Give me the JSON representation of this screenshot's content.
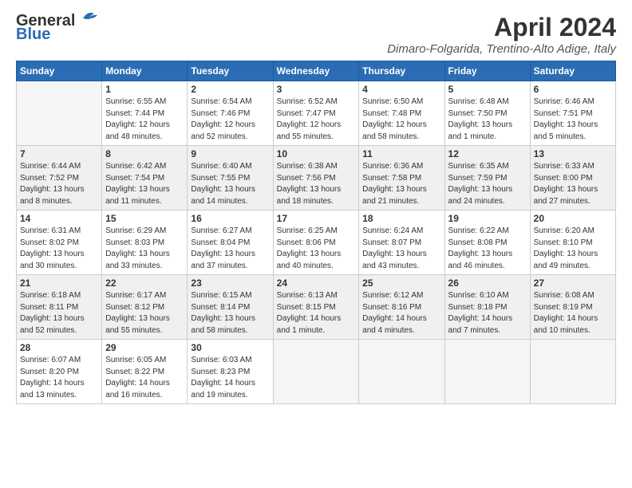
{
  "header": {
    "logo_line1": "General",
    "logo_line2": "Blue",
    "month_title": "April 2024",
    "location": "Dimaro-Folgarida, Trentino-Alto Adige, Italy"
  },
  "weekdays": [
    "Sunday",
    "Monday",
    "Tuesday",
    "Wednesday",
    "Thursday",
    "Friday",
    "Saturday"
  ],
  "weeks": [
    [
      {
        "day": "",
        "info": ""
      },
      {
        "day": "1",
        "info": "Sunrise: 6:55 AM\nSunset: 7:44 PM\nDaylight: 12 hours\nand 48 minutes."
      },
      {
        "day": "2",
        "info": "Sunrise: 6:54 AM\nSunset: 7:46 PM\nDaylight: 12 hours\nand 52 minutes."
      },
      {
        "day": "3",
        "info": "Sunrise: 6:52 AM\nSunset: 7:47 PM\nDaylight: 12 hours\nand 55 minutes."
      },
      {
        "day": "4",
        "info": "Sunrise: 6:50 AM\nSunset: 7:48 PM\nDaylight: 12 hours\nand 58 minutes."
      },
      {
        "day": "5",
        "info": "Sunrise: 6:48 AM\nSunset: 7:50 PM\nDaylight: 13 hours\nand 1 minute."
      },
      {
        "day": "6",
        "info": "Sunrise: 6:46 AM\nSunset: 7:51 PM\nDaylight: 13 hours\nand 5 minutes."
      }
    ],
    [
      {
        "day": "7",
        "info": "Sunrise: 6:44 AM\nSunset: 7:52 PM\nDaylight: 13 hours\nand 8 minutes."
      },
      {
        "day": "8",
        "info": "Sunrise: 6:42 AM\nSunset: 7:54 PM\nDaylight: 13 hours\nand 11 minutes."
      },
      {
        "day": "9",
        "info": "Sunrise: 6:40 AM\nSunset: 7:55 PM\nDaylight: 13 hours\nand 14 minutes."
      },
      {
        "day": "10",
        "info": "Sunrise: 6:38 AM\nSunset: 7:56 PM\nDaylight: 13 hours\nand 18 minutes."
      },
      {
        "day": "11",
        "info": "Sunrise: 6:36 AM\nSunset: 7:58 PM\nDaylight: 13 hours\nand 21 minutes."
      },
      {
        "day": "12",
        "info": "Sunrise: 6:35 AM\nSunset: 7:59 PM\nDaylight: 13 hours\nand 24 minutes."
      },
      {
        "day": "13",
        "info": "Sunrise: 6:33 AM\nSunset: 8:00 PM\nDaylight: 13 hours\nand 27 minutes."
      }
    ],
    [
      {
        "day": "14",
        "info": "Sunrise: 6:31 AM\nSunset: 8:02 PM\nDaylight: 13 hours\nand 30 minutes."
      },
      {
        "day": "15",
        "info": "Sunrise: 6:29 AM\nSunset: 8:03 PM\nDaylight: 13 hours\nand 33 minutes."
      },
      {
        "day": "16",
        "info": "Sunrise: 6:27 AM\nSunset: 8:04 PM\nDaylight: 13 hours\nand 37 minutes."
      },
      {
        "day": "17",
        "info": "Sunrise: 6:25 AM\nSunset: 8:06 PM\nDaylight: 13 hours\nand 40 minutes."
      },
      {
        "day": "18",
        "info": "Sunrise: 6:24 AM\nSunset: 8:07 PM\nDaylight: 13 hours\nand 43 minutes."
      },
      {
        "day": "19",
        "info": "Sunrise: 6:22 AM\nSunset: 8:08 PM\nDaylight: 13 hours\nand 46 minutes."
      },
      {
        "day": "20",
        "info": "Sunrise: 6:20 AM\nSunset: 8:10 PM\nDaylight: 13 hours\nand 49 minutes."
      }
    ],
    [
      {
        "day": "21",
        "info": "Sunrise: 6:18 AM\nSunset: 8:11 PM\nDaylight: 13 hours\nand 52 minutes."
      },
      {
        "day": "22",
        "info": "Sunrise: 6:17 AM\nSunset: 8:12 PM\nDaylight: 13 hours\nand 55 minutes."
      },
      {
        "day": "23",
        "info": "Sunrise: 6:15 AM\nSunset: 8:14 PM\nDaylight: 13 hours\nand 58 minutes."
      },
      {
        "day": "24",
        "info": "Sunrise: 6:13 AM\nSunset: 8:15 PM\nDaylight: 14 hours\nand 1 minute."
      },
      {
        "day": "25",
        "info": "Sunrise: 6:12 AM\nSunset: 8:16 PM\nDaylight: 14 hours\nand 4 minutes."
      },
      {
        "day": "26",
        "info": "Sunrise: 6:10 AM\nSunset: 8:18 PM\nDaylight: 14 hours\nand 7 minutes."
      },
      {
        "day": "27",
        "info": "Sunrise: 6:08 AM\nSunset: 8:19 PM\nDaylight: 14 hours\nand 10 minutes."
      }
    ],
    [
      {
        "day": "28",
        "info": "Sunrise: 6:07 AM\nSunset: 8:20 PM\nDaylight: 14 hours\nand 13 minutes."
      },
      {
        "day": "29",
        "info": "Sunrise: 6:05 AM\nSunset: 8:22 PM\nDaylight: 14 hours\nand 16 minutes."
      },
      {
        "day": "30",
        "info": "Sunrise: 6:03 AM\nSunset: 8:23 PM\nDaylight: 14 hours\nand 19 minutes."
      },
      {
        "day": "",
        "info": ""
      },
      {
        "day": "",
        "info": ""
      },
      {
        "day": "",
        "info": ""
      },
      {
        "day": "",
        "info": ""
      }
    ]
  ]
}
